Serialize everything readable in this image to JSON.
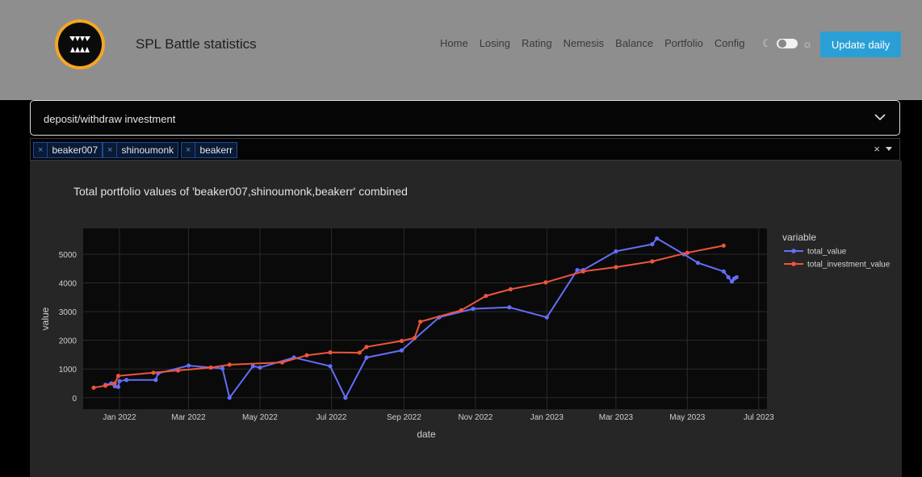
{
  "header": {
    "app_title": "SPL Battle statistics",
    "logo_icon": "fangs-logo-icon",
    "nav": [
      "Home",
      "Losing",
      "Rating",
      "Nemesis",
      "Balance",
      "Portfolio",
      "Config"
    ],
    "update_button": "Update daily",
    "accent_color": "#2a9fd6"
  },
  "accordion": {
    "label": "deposit/withdraw investment"
  },
  "account_select": {
    "selected": [
      "beaker007",
      "shinoumonk",
      "beakerr"
    ],
    "clear_glyph": "×"
  },
  "chart_data": {
    "type": "line",
    "title": "Total portfolio values of 'beaker007,shinoumonk,beakerr' combined",
    "xlabel": "date",
    "ylabel": "value",
    "legend_title": "variable",
    "legend_position": "right",
    "grid": true,
    "ylim": [
      -400,
      5900
    ],
    "xlim": [
      "2021-12-01",
      "2023-07-08"
    ],
    "x_ticks": [
      "Jan 2022",
      "Mar 2022",
      "May 2022",
      "Jul 2022",
      "Sep 2022",
      "Nov 2022",
      "Jan 2023",
      "Mar 2023",
      "May 2023",
      "Jul 2023"
    ],
    "x_tick_dates": [
      "2022-01-01",
      "2022-03-01",
      "2022-05-01",
      "2022-07-01",
      "2022-09-01",
      "2022-11-01",
      "2023-01-01",
      "2023-03-01",
      "2023-05-01",
      "2023-07-01"
    ],
    "y_ticks": [
      "0",
      "1000",
      "2000",
      "3000",
      "4000",
      "5000"
    ],
    "y_tick_values": [
      0,
      1000,
      2000,
      3000,
      4000,
      5000
    ],
    "series": [
      {
        "name": "total_value",
        "color": "#636efa",
        "points": [
          [
            "2021-12-20",
            450
          ],
          [
            "2021-12-25",
            500
          ],
          [
            "2021-12-28",
            400
          ],
          [
            "2021-12-31",
            380
          ],
          [
            "2022-01-01",
            580
          ],
          [
            "2022-01-07",
            620
          ],
          [
            "2022-02-01",
            620
          ],
          [
            "2022-02-03",
            850
          ],
          [
            "2022-03-01",
            1120
          ],
          [
            "2022-03-20",
            1050
          ],
          [
            "2022-03-30",
            1020
          ],
          [
            "2022-04-05",
            0
          ],
          [
            "2022-04-25",
            1100
          ],
          [
            "2022-05-01",
            1050
          ],
          [
            "2022-05-30",
            1400
          ],
          [
            "2022-06-30",
            1100
          ],
          [
            "2022-07-13",
            0
          ],
          [
            "2022-07-31",
            1400
          ],
          [
            "2022-08-30",
            1650
          ],
          [
            "2022-10-01",
            2800
          ],
          [
            "2022-10-30",
            3100
          ],
          [
            "2022-11-30",
            3150
          ],
          [
            "2023-01-01",
            2800
          ],
          [
            "2023-01-27",
            4450
          ],
          [
            "2023-02-01",
            4450
          ],
          [
            "2023-03-01",
            5100
          ],
          [
            "2023-04-01",
            5350
          ],
          [
            "2023-04-05",
            5550
          ],
          [
            "2023-04-28",
            5000
          ],
          [
            "2023-05-10",
            4700
          ],
          [
            "2023-06-01",
            4400
          ],
          [
            "2023-06-05",
            4200
          ],
          [
            "2023-06-08",
            4050
          ],
          [
            "2023-06-10",
            4150
          ],
          [
            "2023-06-12",
            4200
          ]
        ]
      },
      {
        "name": "total_investment_value",
        "color": "#ef553b",
        "points": [
          [
            "2021-12-10",
            350
          ],
          [
            "2021-12-20",
            420
          ],
          [
            "2021-12-28",
            500
          ],
          [
            "2021-12-31",
            760
          ],
          [
            "2022-01-30",
            870
          ],
          [
            "2022-02-20",
            950
          ],
          [
            "2022-03-20",
            1050
          ],
          [
            "2022-04-05",
            1150
          ],
          [
            "2022-05-20",
            1230
          ],
          [
            "2022-06-10",
            1480
          ],
          [
            "2022-06-30",
            1580
          ],
          [
            "2022-07-25",
            1570
          ],
          [
            "2022-07-31",
            1770
          ],
          [
            "2022-08-30",
            1980
          ],
          [
            "2022-09-10",
            2080
          ],
          [
            "2022-09-15",
            2650
          ],
          [
            "2022-10-20",
            3050
          ],
          [
            "2022-11-10",
            3550
          ],
          [
            "2022-12-01",
            3780
          ],
          [
            "2022-12-31",
            4020
          ],
          [
            "2023-02-01",
            4400
          ],
          [
            "2023-03-01",
            4550
          ],
          [
            "2023-04-01",
            4750
          ],
          [
            "2023-05-01",
            5050
          ],
          [
            "2023-06-01",
            5300
          ]
        ]
      }
    ]
  }
}
